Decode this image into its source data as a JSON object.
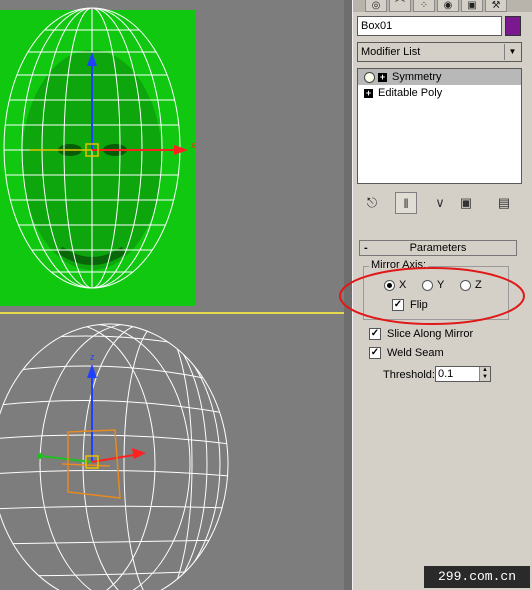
{
  "command_panel": {
    "tabs": [
      "◎",
      "⌒",
      "⁘",
      "◉",
      "▣",
      "⚒"
    ],
    "object_name": "Box01",
    "object_color": "#7a1890",
    "modifier_list": "Modifier List",
    "stack": [
      {
        "label": "Symmetry",
        "selected": true
      },
      {
        "label": "Editable Poly",
        "selected": false
      }
    ],
    "toolbar_icons": [
      "pin-stack-icon",
      "show-end-result-icon",
      "make-unique-icon",
      "remove-modifier-icon",
      "configure-sets-icon"
    ]
  },
  "parameters": {
    "rollout_minus": "-",
    "title": "Parameters",
    "mirror_axis_label": "Mirror Axis:",
    "axes": [
      {
        "label": "X",
        "selected": true
      },
      {
        "label": "Y",
        "selected": false
      },
      {
        "label": "Z",
        "selected": false
      }
    ],
    "flip_label": "Flip",
    "flip_checked": true,
    "slice_label": "Slice Along Mirror",
    "slice_checked": true,
    "weld_label": "Weld Seam",
    "weld_checked": true,
    "threshold_label": "Threshold:",
    "threshold_value": "0.1"
  },
  "viewports": {
    "top_gizmo_label": "x",
    "bottom_gizmo_label": "z",
    "active_border_color": "#e8d84e",
    "background_color": "#11c811"
  },
  "watermark": "299.com.cn"
}
